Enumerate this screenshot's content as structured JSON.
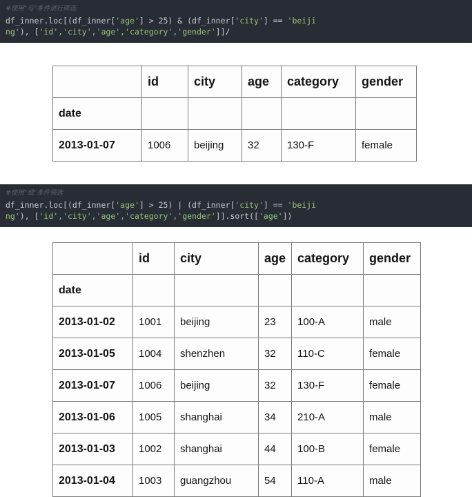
{
  "blocks": [
    {
      "comment": "#使用\"与\"条件进行筛选",
      "code_line1_a": "df_inner.loc[(df_inner[",
      "code_line1_str1": "'age'",
      "code_line1_b": "] > 25) & (df_inner[",
      "code_line1_str2": "'city'",
      "code_line1_c": "] == ",
      "code_line1_str3": "'beiji",
      "code_line2_str_start": "ng'",
      "code_line2_a": "), [",
      "code_line2_cols": "'id','city','age','category','gender'",
      "code_line2_b": "]]/",
      "full_code": "df_inner.loc[(df_inner['age'] > 25) & (df_inner['city'] == 'beijing'), ['id','city','age','category','gender']]/"
    },
    {
      "comment": "#使用\"或\"条件筛选",
      "code_line1_a": "df_inner.loc[(df_inner[",
      "code_line1_str1": "'age'",
      "code_line1_b": "] > 25) | (df_inner[",
      "code_line1_str2": "'city'",
      "code_line1_c": "] == ",
      "code_line1_str3": "'beiji",
      "code_line2_str_start": "ng'",
      "code_line2_a": "), [",
      "code_line2_cols": "'id','city','age','category','gender'",
      "code_line2_b": "]].sort([",
      "code_line2_str_sort": "'age'",
      "code_line2_c": "])",
      "full_code": "df_inner.loc[(df_inner['age'] > 25) | (df_inner['city'] == 'beijing'), ['id','city','age','category','gender']].sort(['age'])"
    }
  ],
  "table1": {
    "columns": [
      "",
      "id",
      "city",
      "age",
      "category",
      "gender"
    ],
    "index_name": "date",
    "rows": [
      [
        "2013-01-07",
        "1006",
        "beijing",
        "32",
        "130-F",
        "female"
      ]
    ]
  },
  "table2": {
    "columns": [
      "",
      "id",
      "city",
      "age",
      "category",
      "gender"
    ],
    "index_name": "date",
    "rows": [
      [
        "2013-01-02",
        "1001",
        "beijing",
        "23",
        "100-A",
        "male"
      ],
      [
        "2013-01-05",
        "1004",
        "shenzhen",
        "32",
        "110-C",
        "female"
      ],
      [
        "2013-01-07",
        "1006",
        "beijing",
        "32",
        "130-F",
        "female"
      ],
      [
        "2013-01-06",
        "1005",
        "shanghai",
        "34",
        "210-A",
        "male"
      ],
      [
        "2013-01-03",
        "1002",
        "shanghai",
        "44",
        "100-B",
        "female"
      ],
      [
        "2013-01-04",
        "1003",
        "guangzhou",
        "54",
        "110-A",
        "male"
      ]
    ]
  },
  "colors": {
    "code_background": "#282c34",
    "code_text": "#c5cbd6",
    "code_string": "#99c27c",
    "code_comment": "#5b6270",
    "code_bracket": "#cf7a52",
    "table_border": "#7a7a7a",
    "page_background": "#ffffff"
  }
}
